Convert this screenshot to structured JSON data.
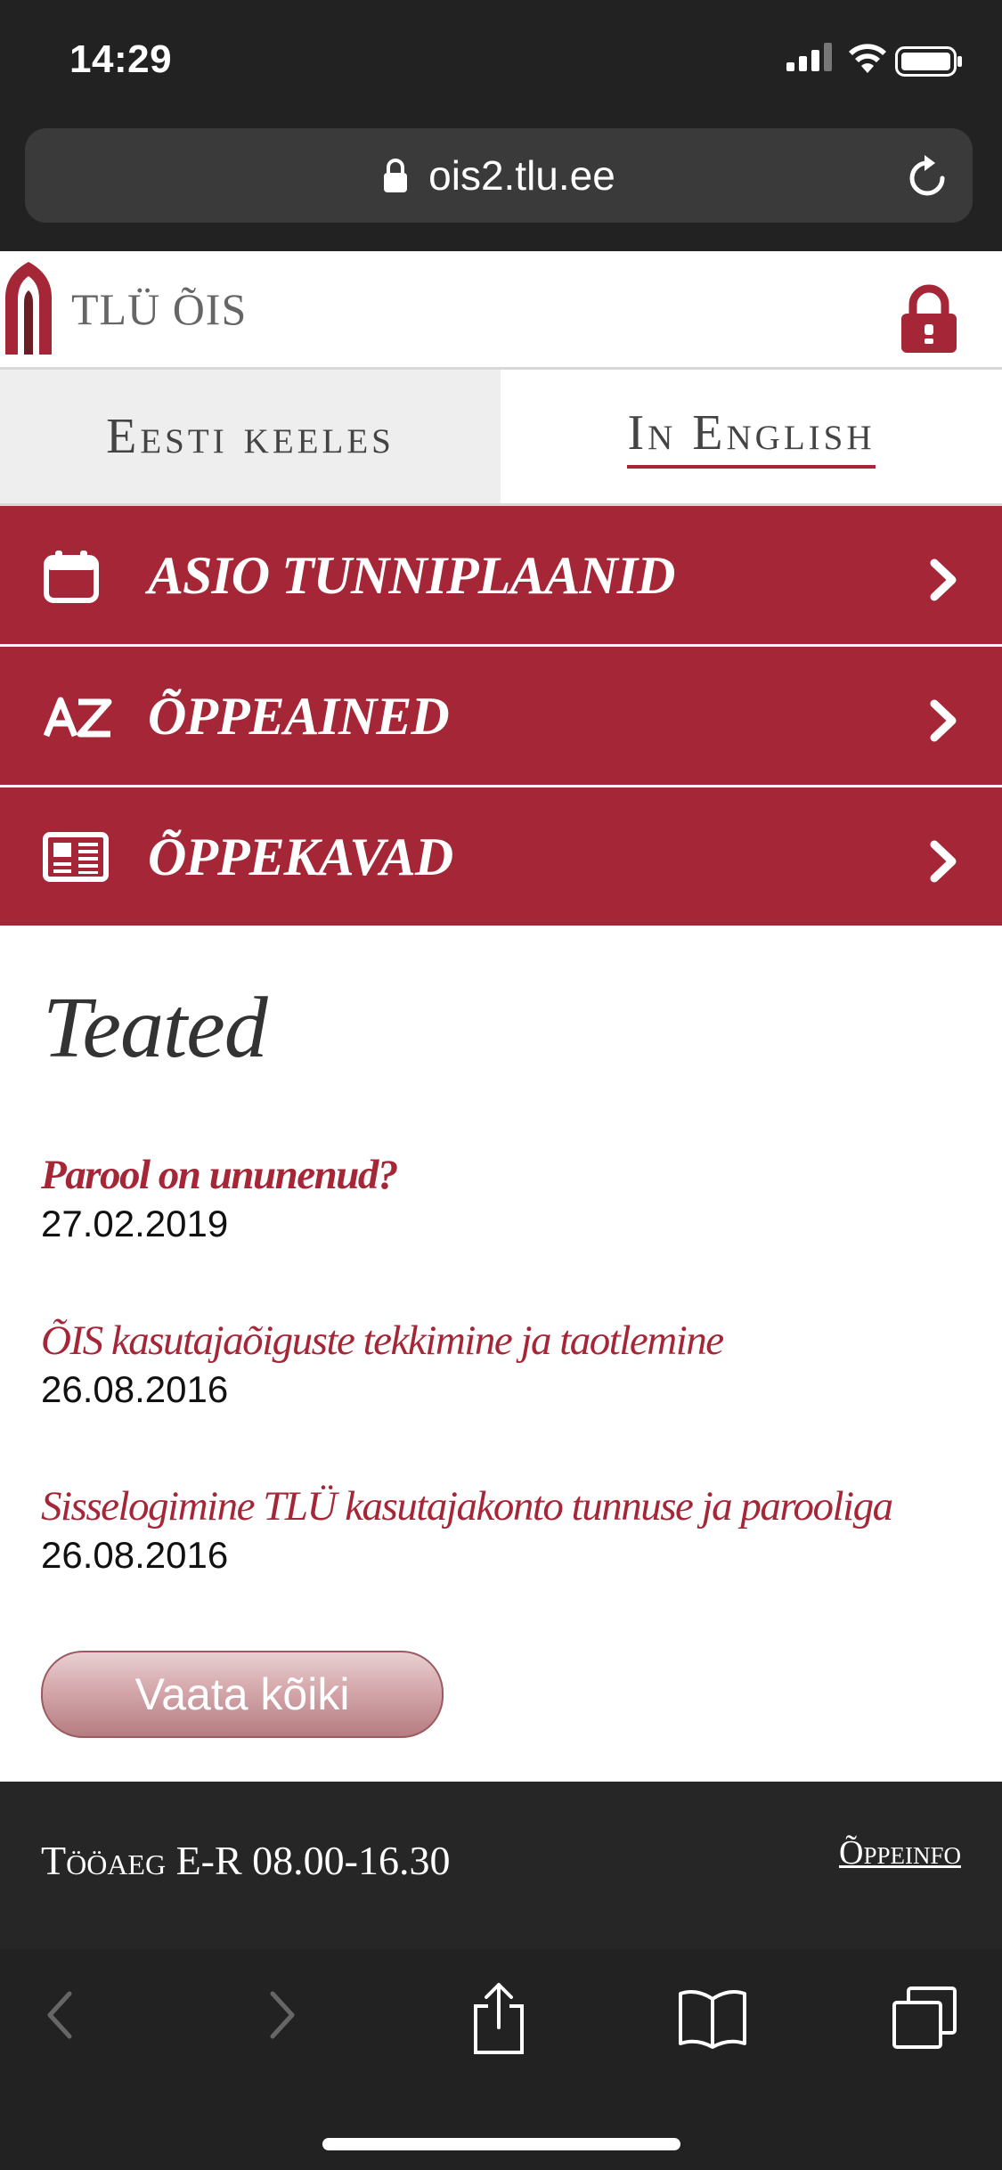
{
  "status_bar": {
    "time": "14:29"
  },
  "browser": {
    "url": "ois2.tlu.ee"
  },
  "header": {
    "logo_text": "TLÜ ÕIS"
  },
  "language_tabs": [
    {
      "label": "Eesti keeles",
      "active": false
    },
    {
      "label": "In English",
      "active": true
    }
  ],
  "menu": [
    {
      "label": "ASIO TUNNIPLAANID",
      "icon": "calendar-icon"
    },
    {
      "label": "ÕPPEAINED",
      "icon": "az-icon"
    },
    {
      "label": "ÕPPEKAVAD",
      "icon": "curriculum-icon"
    }
  ],
  "announcements": {
    "title": "Teated",
    "items": [
      {
        "title": "Parool on ununenud?",
        "date": "27.02.2019"
      },
      {
        "title": "ÕIS kasutajaõiguste tekkimine ja taotlemine",
        "date": "26.08.2016"
      },
      {
        "title": "Sisselogimine TLÜ kasutajakonto tunnuse ja parooliga",
        "date": "26.08.2016"
      }
    ],
    "view_all_label": "Vaata kõiki"
  },
  "footer": {
    "hours": "Tööaeg E-R 08.00-16.30",
    "link": "Õppeinfo"
  },
  "colors": {
    "brand": "#a52737",
    "dark": "#222222"
  }
}
